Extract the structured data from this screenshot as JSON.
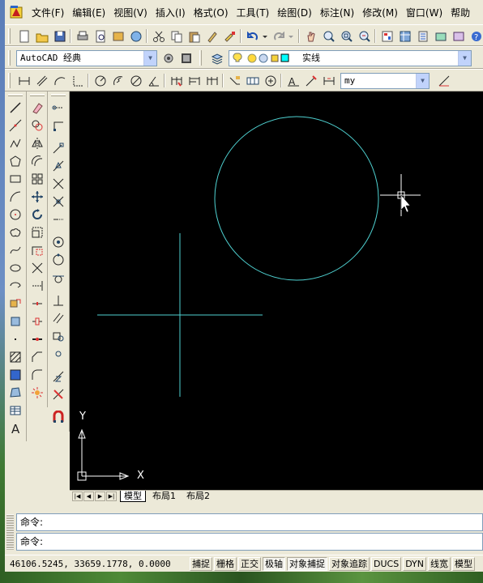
{
  "menu": [
    {
      "name": "menu-file",
      "label": "文件(F)"
    },
    {
      "name": "menu-edit",
      "label": "编辑(E)"
    },
    {
      "name": "menu-view",
      "label": "视图(V)"
    },
    {
      "name": "menu-insert",
      "label": "插入(I)"
    },
    {
      "name": "menu-format",
      "label": "格式(O)"
    },
    {
      "name": "menu-tools",
      "label": "工具(T)"
    },
    {
      "name": "menu-draw",
      "label": "绘图(D)"
    },
    {
      "name": "menu-dimension",
      "label": "标注(N)"
    },
    {
      "name": "menu-modify",
      "label": "修改(M)"
    },
    {
      "name": "menu-window",
      "label": "窗口(W)"
    },
    {
      "name": "menu-help",
      "label": "帮助"
    }
  ],
  "workspace_combo": {
    "value": "AutoCAD 经典"
  },
  "linetype_combo": {
    "value": "实线"
  },
  "dimstyle_combo": {
    "value": "my"
  },
  "canvas": {
    "background": "#000000",
    "entity_color": "#4fd2d2",
    "ucs": {
      "x_label": "X",
      "y_label": "Y"
    }
  },
  "layout_tabs": [
    {
      "name": "tab-model",
      "label": "模型",
      "active": true
    },
    {
      "name": "tab-layout1",
      "label": "布局1",
      "active": false
    },
    {
      "name": "tab-layout2",
      "label": "布局2",
      "active": false
    }
  ],
  "command": {
    "prompt1": "命令:",
    "prompt2": "命令:"
  },
  "status": {
    "coordinates": "46106.5245, 33659.1778, 0.0000",
    "toggles": [
      {
        "name": "snap-toggle",
        "label": "捕捉",
        "on": false
      },
      {
        "name": "grid-toggle",
        "label": "栅格",
        "on": false
      },
      {
        "name": "ortho-toggle",
        "label": "正交",
        "on": false
      },
      {
        "name": "polar-toggle",
        "label": "极轴",
        "on": true
      },
      {
        "name": "osnap-toggle",
        "label": "对象捕捉",
        "on": true
      },
      {
        "name": "otrack-toggle",
        "label": "对象追踪",
        "on": false
      },
      {
        "name": "ducs-toggle",
        "label": "DUCS",
        "on": false
      },
      {
        "name": "dyn-toggle",
        "label": "DYN",
        "on": false
      },
      {
        "name": "lineweight-toggle",
        "label": "线宽",
        "on": false
      },
      {
        "name": "model-toggle",
        "label": "模型",
        "on": false
      }
    ]
  },
  "icons": {
    "toolbar_standard": [
      "new-icon",
      "open-icon",
      "save-icon",
      "print-icon",
      "preview-icon",
      "publish-icon",
      "3d-dwf-icon",
      "cut-icon",
      "copy-icon",
      "paste-icon",
      "match-properties-icon",
      "block-editor-icon",
      "undo-icon",
      "redo-icon",
      "pan-icon",
      "zoom-realtime-icon",
      "zoom-window-icon",
      "zoom-previous-icon",
      "properties-icon",
      "design-center-icon",
      "tool-palettes-icon",
      "sheet-set-icon",
      "markup-icon"
    ],
    "toolbar_layers": [
      "layer-manager-icon",
      "layer-on-icon",
      "layer-freeze-icon",
      "layer-lock-icon",
      "layer-color-icon"
    ],
    "toolbar_dimension": [
      "linear-dim-icon",
      "aligned-dim-icon",
      "arc-length-icon",
      "ordinate-icon",
      "radius-icon",
      "jogged-icon",
      "diameter-icon",
      "angular-icon",
      "quick-dim-icon",
      "baseline-icon",
      "continue-icon",
      "qleader-icon",
      "tolerance-icon",
      "center-mark-icon",
      "dimedit-icon",
      "dimtedit-icon",
      "dimupdate-icon",
      "dimstyle-icon"
    ],
    "draw": [
      "line-icon",
      "construction-line-icon",
      "polyline-icon",
      "polygon-icon",
      "rectangle-icon",
      "arc-icon",
      "circle-icon",
      "revision-cloud-icon",
      "spline-icon",
      "ellipse-icon",
      "ellipse-arc-icon",
      "insert-block-icon",
      "make-block-icon",
      "point-icon",
      "hatch-icon",
      "gradient-icon",
      "region-icon",
      "table-icon",
      "mtext-icon"
    ],
    "modify": [
      "erase-icon",
      "copy-object-icon",
      "mirror-icon",
      "offset-icon",
      "array-icon",
      "move-icon",
      "rotate-icon",
      "scale-icon",
      "stretch-icon",
      "trim-icon",
      "extend-icon",
      "break-at-point-icon",
      "break-icon",
      "join-icon",
      "chamfer-icon",
      "fillet-icon",
      "explode-icon"
    ],
    "osnap": [
      "temp-track-icon",
      "snap-from-icon",
      "endpoint-icon",
      "midpoint-icon",
      "intersection-icon",
      "apparent-intersection-icon",
      "extension-icon",
      "center-snap-icon",
      "quadrant-icon",
      "tangent-icon",
      "perpendicular-icon",
      "parallel-icon",
      "insertion-icon",
      "node-icon",
      "nearest-icon",
      "snap-none-icon",
      "osnap-settings-icon"
    ]
  }
}
